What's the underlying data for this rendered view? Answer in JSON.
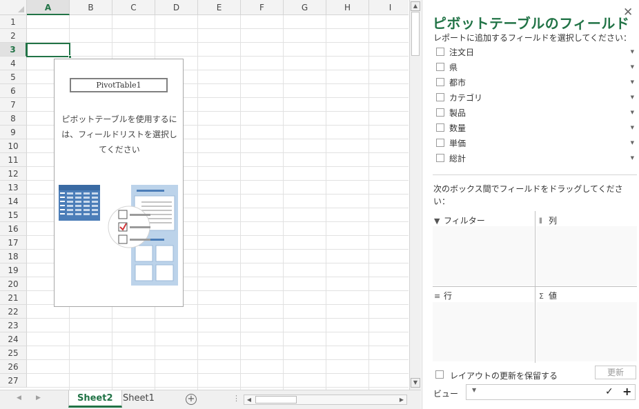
{
  "columns": [
    "A",
    "B",
    "C",
    "D",
    "E",
    "F",
    "G",
    "H",
    "I"
  ],
  "selected_column": "A",
  "rows": [
    "1",
    "2",
    "3",
    "4",
    "5",
    "6",
    "7",
    "8",
    "9",
    "10",
    "11",
    "12",
    "13",
    "14",
    "15",
    "16",
    "17",
    "18",
    "19",
    "20",
    "21",
    "22",
    "23",
    "24",
    "25",
    "26",
    "27"
  ],
  "selected_row": "3",
  "pivot_placeholder": {
    "name": "PivotTable1",
    "message": "ピボットテーブルを使用するには、フィールドリストを選択してください"
  },
  "sheet_tabs": [
    {
      "label": "Sheet2",
      "active": true
    },
    {
      "label": "Sheet1",
      "active": false
    }
  ],
  "panel": {
    "title": "ピボットテーブルのフィールド",
    "subtitle": "レポートに追加するフィールドを選択してください：",
    "fields": [
      "注文日",
      "県",
      "都市",
      "カテゴリ",
      "製品",
      "数量",
      "単価",
      "総計"
    ],
    "drag_text": "次のボックス間でフィールドをドラッグしてください：",
    "areas": {
      "filter": "フィルター",
      "columns": "列",
      "rows": "行",
      "values": "値"
    },
    "defer_label": "レイアウトの更新を保留する",
    "update_label": "更新",
    "view_label": "ビュー"
  },
  "colors": {
    "accent": "#217346",
    "illustration_blue": "#4b7db8",
    "illustration_light": "#bcd3ea"
  }
}
